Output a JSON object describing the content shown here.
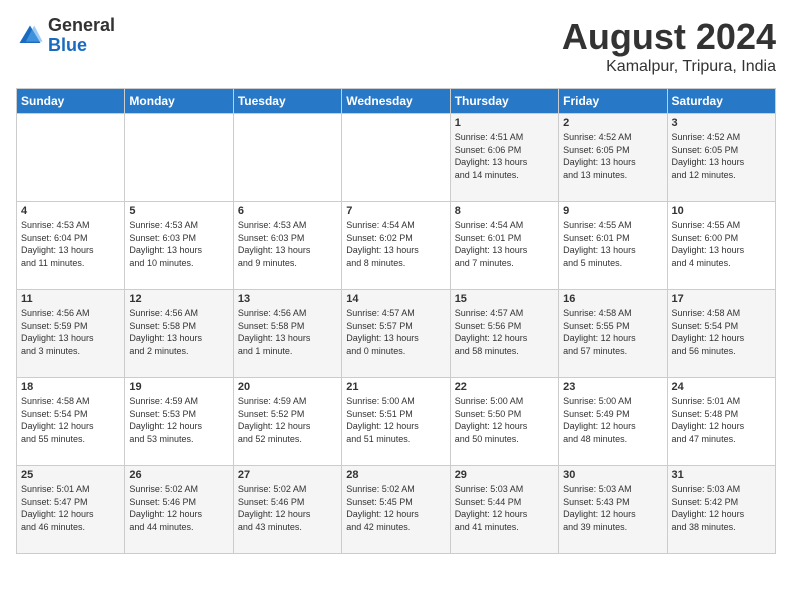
{
  "logo": {
    "general": "General",
    "blue": "Blue"
  },
  "title": "August 2024",
  "location": "Kamalpur, Tripura, India",
  "days_of_week": [
    "Sunday",
    "Monday",
    "Tuesday",
    "Wednesday",
    "Thursday",
    "Friday",
    "Saturday"
  ],
  "weeks": [
    [
      {
        "day": "",
        "info": ""
      },
      {
        "day": "",
        "info": ""
      },
      {
        "day": "",
        "info": ""
      },
      {
        "day": "",
        "info": ""
      },
      {
        "day": "1",
        "info": "Sunrise: 4:51 AM\nSunset: 6:06 PM\nDaylight: 13 hours\nand 14 minutes."
      },
      {
        "day": "2",
        "info": "Sunrise: 4:52 AM\nSunset: 6:05 PM\nDaylight: 13 hours\nand 13 minutes."
      },
      {
        "day": "3",
        "info": "Sunrise: 4:52 AM\nSunset: 6:05 PM\nDaylight: 13 hours\nand 12 minutes."
      }
    ],
    [
      {
        "day": "4",
        "info": "Sunrise: 4:53 AM\nSunset: 6:04 PM\nDaylight: 13 hours\nand 11 minutes."
      },
      {
        "day": "5",
        "info": "Sunrise: 4:53 AM\nSunset: 6:03 PM\nDaylight: 13 hours\nand 10 minutes."
      },
      {
        "day": "6",
        "info": "Sunrise: 4:53 AM\nSunset: 6:03 PM\nDaylight: 13 hours\nand 9 minutes."
      },
      {
        "day": "7",
        "info": "Sunrise: 4:54 AM\nSunset: 6:02 PM\nDaylight: 13 hours\nand 8 minutes."
      },
      {
        "day": "8",
        "info": "Sunrise: 4:54 AM\nSunset: 6:01 PM\nDaylight: 13 hours\nand 7 minutes."
      },
      {
        "day": "9",
        "info": "Sunrise: 4:55 AM\nSunset: 6:01 PM\nDaylight: 13 hours\nand 5 minutes."
      },
      {
        "day": "10",
        "info": "Sunrise: 4:55 AM\nSunset: 6:00 PM\nDaylight: 13 hours\nand 4 minutes."
      }
    ],
    [
      {
        "day": "11",
        "info": "Sunrise: 4:56 AM\nSunset: 5:59 PM\nDaylight: 13 hours\nand 3 minutes."
      },
      {
        "day": "12",
        "info": "Sunrise: 4:56 AM\nSunset: 5:58 PM\nDaylight: 13 hours\nand 2 minutes."
      },
      {
        "day": "13",
        "info": "Sunrise: 4:56 AM\nSunset: 5:58 PM\nDaylight: 13 hours\nand 1 minute."
      },
      {
        "day": "14",
        "info": "Sunrise: 4:57 AM\nSunset: 5:57 PM\nDaylight: 13 hours\nand 0 minutes."
      },
      {
        "day": "15",
        "info": "Sunrise: 4:57 AM\nSunset: 5:56 PM\nDaylight: 12 hours\nand 58 minutes."
      },
      {
        "day": "16",
        "info": "Sunrise: 4:58 AM\nSunset: 5:55 PM\nDaylight: 12 hours\nand 57 minutes."
      },
      {
        "day": "17",
        "info": "Sunrise: 4:58 AM\nSunset: 5:54 PM\nDaylight: 12 hours\nand 56 minutes."
      }
    ],
    [
      {
        "day": "18",
        "info": "Sunrise: 4:58 AM\nSunset: 5:54 PM\nDaylight: 12 hours\nand 55 minutes."
      },
      {
        "day": "19",
        "info": "Sunrise: 4:59 AM\nSunset: 5:53 PM\nDaylight: 12 hours\nand 53 minutes."
      },
      {
        "day": "20",
        "info": "Sunrise: 4:59 AM\nSunset: 5:52 PM\nDaylight: 12 hours\nand 52 minutes."
      },
      {
        "day": "21",
        "info": "Sunrise: 5:00 AM\nSunset: 5:51 PM\nDaylight: 12 hours\nand 51 minutes."
      },
      {
        "day": "22",
        "info": "Sunrise: 5:00 AM\nSunset: 5:50 PM\nDaylight: 12 hours\nand 50 minutes."
      },
      {
        "day": "23",
        "info": "Sunrise: 5:00 AM\nSunset: 5:49 PM\nDaylight: 12 hours\nand 48 minutes."
      },
      {
        "day": "24",
        "info": "Sunrise: 5:01 AM\nSunset: 5:48 PM\nDaylight: 12 hours\nand 47 minutes."
      }
    ],
    [
      {
        "day": "25",
        "info": "Sunrise: 5:01 AM\nSunset: 5:47 PM\nDaylight: 12 hours\nand 46 minutes."
      },
      {
        "day": "26",
        "info": "Sunrise: 5:02 AM\nSunset: 5:46 PM\nDaylight: 12 hours\nand 44 minutes."
      },
      {
        "day": "27",
        "info": "Sunrise: 5:02 AM\nSunset: 5:46 PM\nDaylight: 12 hours\nand 43 minutes."
      },
      {
        "day": "28",
        "info": "Sunrise: 5:02 AM\nSunset: 5:45 PM\nDaylight: 12 hours\nand 42 minutes."
      },
      {
        "day": "29",
        "info": "Sunrise: 5:03 AM\nSunset: 5:44 PM\nDaylight: 12 hours\nand 41 minutes."
      },
      {
        "day": "30",
        "info": "Sunrise: 5:03 AM\nSunset: 5:43 PM\nDaylight: 12 hours\nand 39 minutes."
      },
      {
        "day": "31",
        "info": "Sunrise: 5:03 AM\nSunset: 5:42 PM\nDaylight: 12 hours\nand 38 minutes."
      }
    ]
  ]
}
